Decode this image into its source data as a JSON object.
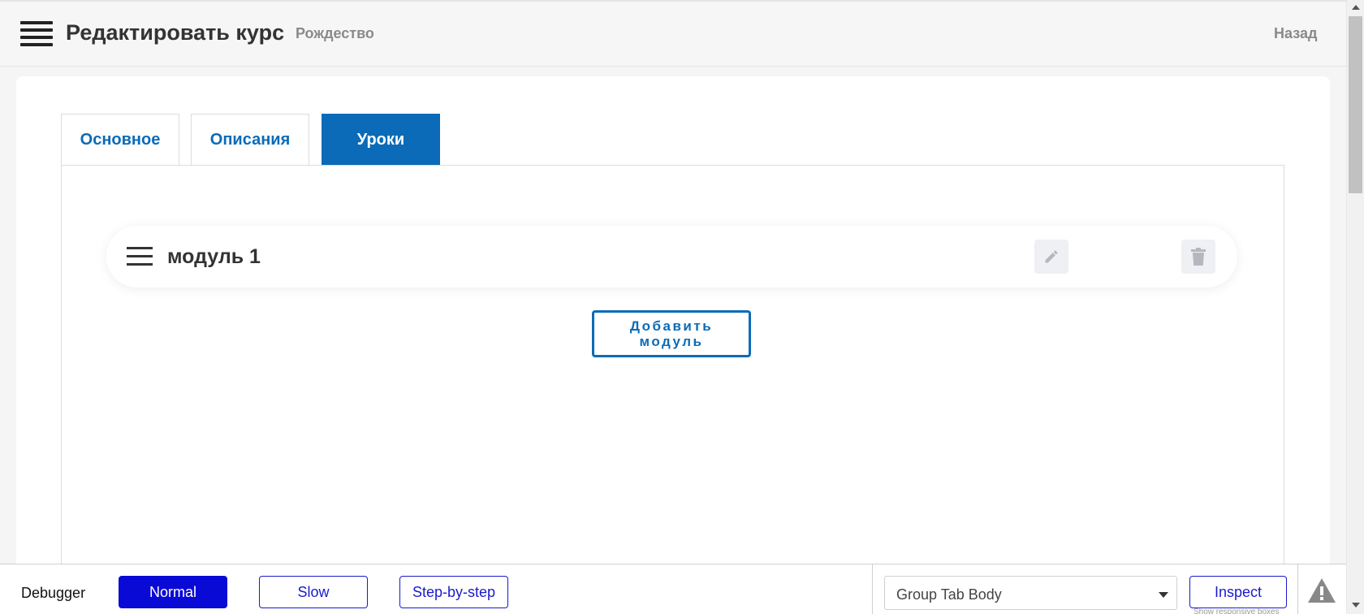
{
  "header": {
    "title": "Редактировать курс",
    "subtitle": "Рождество",
    "back_label": "Назад",
    "menu_icon": "hamburger-icon"
  },
  "tabs": [
    {
      "label": "Основное",
      "active": false
    },
    {
      "label": "Описания",
      "active": false
    },
    {
      "label": "Уроки",
      "active": true
    }
  ],
  "modules": [
    {
      "title": "модуль 1",
      "drag_icon": "drag-handle-icon",
      "edit_icon": "pencil-icon",
      "delete_icon": "trash-icon"
    }
  ],
  "add_module_label_line1": "Добавить",
  "add_module_label_line2": "модуль",
  "debugger": {
    "label": "Debugger",
    "modes": [
      "Normal",
      "Slow",
      "Step-by-step"
    ],
    "active_mode": "Normal",
    "selected_element": "Group Tab Body",
    "inspect_label": "Inspect",
    "hint": "Show responsive boxes",
    "warning_icon": "warning-icon"
  },
  "colors": {
    "accent": "#0b6bb8",
    "debugger_accent": "#0a0ad6",
    "text": "#333333",
    "muted": "#8a8a8a"
  }
}
